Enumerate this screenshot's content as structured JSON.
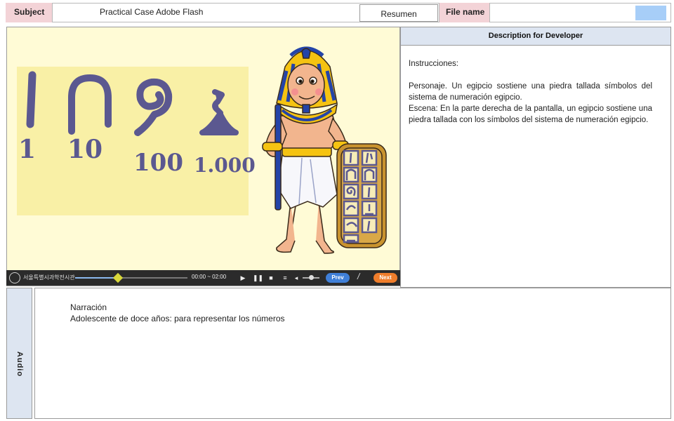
{
  "header": {
    "subject_label": "Subject",
    "subject_value": "Practical Case Adobe Flash",
    "resumen_label": "Resumen",
    "file_name_label": "File name",
    "file_name_value": ""
  },
  "stage": {
    "numerals": [
      {
        "digits": "1"
      },
      {
        "digits": "10"
      },
      {
        "digits": "100"
      },
      {
        "digits": "1.000"
      }
    ]
  },
  "player": {
    "logo_text": "서울특별시과학전시관",
    "time": "00:00 ~ 02:00",
    "progress": 0.38,
    "prev_label": "Prev",
    "separator": "/",
    "next_label": "Next"
  },
  "description": {
    "title": "Description for Developer",
    "intro": "Instrucciones:",
    "character": "Personaje. Un egipcio sostiene una piedra tallada símbolos del sistema de numeración egipcio.",
    "scene": "Escena: En la parte derecha de la pantalla, un egipcio sostiene una piedra tallada con los símbolos del sistema de numeración egipcio."
  },
  "audio": {
    "label": "Audio",
    "title": "Narración",
    "line": "Adolescente de doce años: para representar los números"
  },
  "colors": {
    "label_pink": "#f3d3d7",
    "panel_blue": "#dde5f1",
    "swatch_blue": "#a7cef8",
    "stage_bg": "#fffbd6",
    "hieroglyph": "#5b5890",
    "prev_btn": "#3f7fd8",
    "next_btn": "#ef7d2b"
  }
}
